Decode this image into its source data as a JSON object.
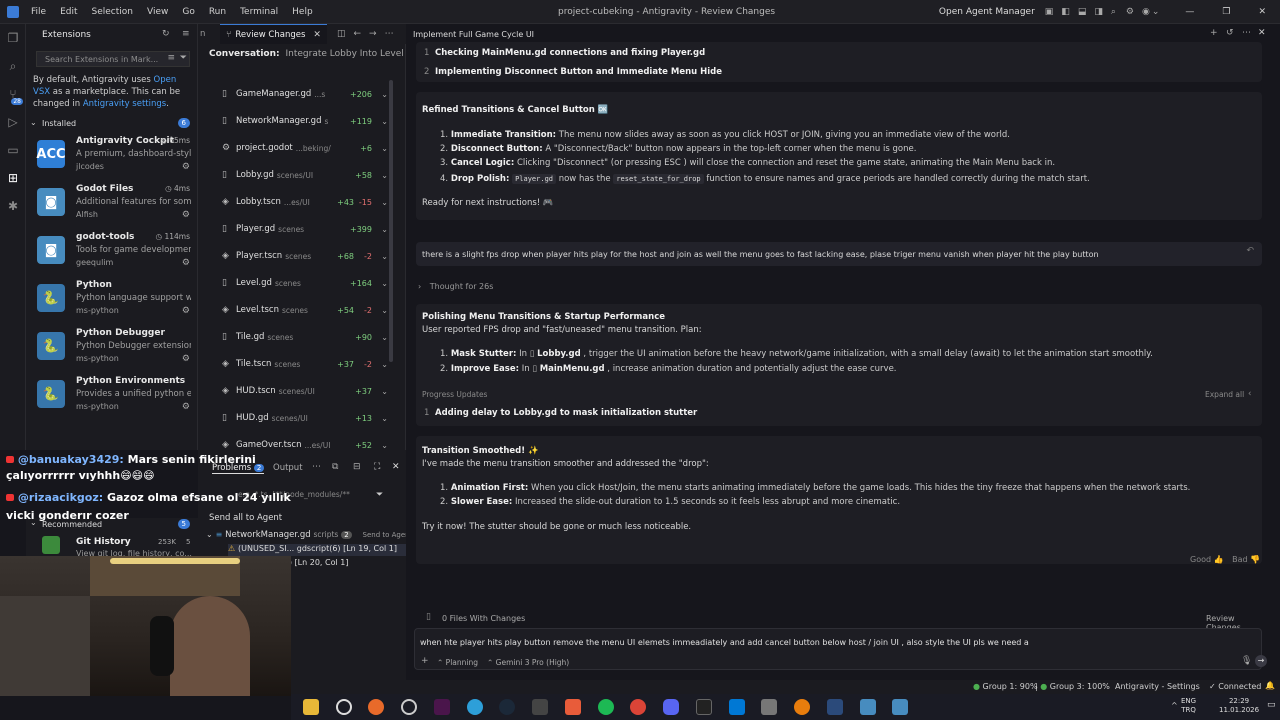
{
  "titlebar": {
    "menu": [
      "File",
      "Edit",
      "Selection",
      "View",
      "Go",
      "Run",
      "Terminal",
      "Help"
    ],
    "title": "project-cubeking - Antigravity - Review Changes",
    "open_agent_manager": "Open Agent Manager"
  },
  "extensions": {
    "header": "Extensions",
    "search_placeholder": "Search Extensions in Mark...",
    "notice": [
      "By default, Antigravity uses",
      "Open VSX",
      "as",
      "a marketplace. This can be changed in",
      "Antigravity settings",
      "."
    ],
    "installed_label": "Installed",
    "installed_count": "6",
    "items": [
      {
        "name": "Antigravity Cockpit",
        "meta": "65ms",
        "desc": "A premium, dashboard-style...",
        "publisher": "jlcodes",
        "icon": "cockpit-icon",
        "color": "#2f7fd6"
      },
      {
        "name": "Godot Files",
        "meta": "4ms",
        "desc": "Additional features for some...",
        "publisher": "Alfish",
        "icon": "godot-icon",
        "color": "#478cbf"
      },
      {
        "name": "godot-tools",
        "meta": "114ms",
        "desc": "Tools for game developmen...",
        "publisher": "geequlim",
        "icon": "godot-icon",
        "color": "#478cbf"
      },
      {
        "name": "Python",
        "meta": "",
        "desc": "Python language support wi...",
        "publisher": "ms-python",
        "icon": "python-icon",
        "color": "#3776ab"
      },
      {
        "name": "Python Debugger",
        "meta": "",
        "desc": "Python Debugger extension...",
        "publisher": "ms-python",
        "icon": "python-icon",
        "color": "#3776ab"
      },
      {
        "name": "Python Environments",
        "meta": "",
        "desc": "Provides a unified python e...",
        "publisher": "ms-python",
        "icon": "python-icon",
        "color": "#3776ab"
      }
    ],
    "recommended_label": "Recommended",
    "recommended_count": "5",
    "rec_item": {
      "name": "Git History",
      "meta": "253K",
      "rating": "5",
      "desc": "View git log, file history, co..."
    }
  },
  "files": {
    "tab_partial": "n",
    "tab_active": "Review Changes",
    "conversation_label": "Conversation:",
    "conversation_title": "Integrate Lobby Into Level",
    "rows": [
      {
        "name": "GameManager.gd",
        "path": "...s",
        "add": "+206",
        "del": ""
      },
      {
        "name": "NetworkManager.gd",
        "path": "s",
        "add": "+119",
        "del": ""
      },
      {
        "name": "project.godot",
        "path": "...beking/",
        "add": "+6",
        "del": ""
      },
      {
        "name": "Lobby.gd",
        "path": "scenes/UI",
        "add": "+58",
        "del": ""
      },
      {
        "name": "Lobby.tscn",
        "path": "...es/UI",
        "add": "+43",
        "del": "-15"
      },
      {
        "name": "Player.gd",
        "path": "scenes",
        "add": "+399",
        "del": ""
      },
      {
        "name": "Player.tscn",
        "path": "scenes",
        "add": "+68",
        "del": "-2"
      },
      {
        "name": "Level.gd",
        "path": "scenes",
        "add": "+164",
        "del": ""
      },
      {
        "name": "Level.tscn",
        "path": "scenes",
        "add": "+54",
        "del": "-2"
      },
      {
        "name": "Tile.gd",
        "path": "scenes",
        "add": "+90",
        "del": ""
      },
      {
        "name": "Tile.tscn",
        "path": "scenes",
        "add": "+37",
        "del": "-2"
      },
      {
        "name": "HUD.tscn",
        "path": "scenes/UI",
        "add": "+37",
        "del": ""
      },
      {
        "name": "HUD.gd",
        "path": "scenes/UI",
        "add": "+13",
        "del": ""
      },
      {
        "name": "GameOver.tscn",
        "path": "...es/UI",
        "add": "+52",
        "del": ""
      }
    ]
  },
  "problems": {
    "tab_problems": "Problems",
    "problems_count": "2",
    "tab_output": "Output",
    "filter_placeholder": "e.g. *.ts, !**/node_modules/**",
    "send_all": "Send all to Agent",
    "file": "NetworkManager.gd",
    "file_path": "scripts",
    "file_count": "2",
    "send_label": "Send to Agen",
    "issues": [
      {
        "text": "(UNUSED_SI... gdscript(6) [Ln 19, Col 1]"
      },
      {
        "text": "... gdscript(6) [Ln 20, Col 1]"
      }
    ]
  },
  "stream_chat": [
    {
      "user": "@banuakay3429:",
      "msg": "Mars senin fikirlerini"
    },
    {
      "user": "",
      "msg": "çalıyorrrrrr vıyhhh😄😄😄"
    },
    {
      "user": "@rizaacikgoz:",
      "msg": "Gazoz olma efsane ol 24 yıllık"
    },
    {
      "user": "",
      "msg": "vicki gonderır cozer"
    }
  ],
  "chat": {
    "header_title": "Implement Full Game Cycle UI",
    "progress_items": [
      {
        "num": "1",
        "text": "Checking MainMenu.gd connections and fixing Player.gd"
      },
      {
        "num": "2",
        "text": "Implementing Disconnect Button and Immediate Menu Hide"
      }
    ],
    "msg1": {
      "title": "Refined Transitions & Cancel Button 🆗",
      "bullets": [
        {
          "num": "1.",
          "label": "Immediate Transition:",
          "text": "The menu now slides away as soon as you click HOST or JOIN, giving you an immediate view of the world."
        },
        {
          "num": "2.",
          "label": "Disconnect Button:",
          "text": "A \"Disconnect/Back\" button now appears in the top-left corner when the menu is gone."
        },
        {
          "num": "3.",
          "label": "Cancel Logic:",
          "text": "Clicking \"Disconnect\" (or pressing ESC ) will close the connection and reset the game state, animating the Main Menu back in."
        },
        {
          "num": "4.",
          "label": "Drop Polish:",
          "code1": "Player.gd",
          "mid": "now has the",
          "code2": "reset_state_for_drop",
          "text": "function to ensure names and grace periods are handled correctly during the match start."
        }
      ],
      "footer": "Ready for next instructions! 🎮"
    },
    "user_msg": "there is a slight fps drop when player hits play for the host and join as well the menu goes to fast lacking ease, plase triger menu vanish when player hit the play button",
    "thought": "Thought for 26s",
    "plan": {
      "title": "Polishing Menu Transitions & Startup Performance",
      "subtitle": "User reported FPS drop and \"fast/uneased\" menu transition. Plan:",
      "bullets": [
        {
          "num": "1.",
          "label": "Mask Stutter:",
          "pre": "In",
          "file": "Lobby.gd",
          "text": ", trigger the UI animation before the heavy network/game initialization, with a small delay (await) to let the animation start smoothly."
        },
        {
          "num": "2.",
          "label": "Improve Ease:",
          "pre": "In",
          "file": "MainMenu.gd",
          "text": ", increase animation duration and potentially adjust the ease curve."
        }
      ],
      "progress_label": "Progress Updates",
      "expand_all": "Expand all",
      "progress_item": {
        "num": "1",
        "text": "Adding delay to Lobby.gd to mask initialization stutter"
      }
    },
    "msg2": {
      "title": "Transition Smoothed! ✨",
      "subtitle": "I've made the menu transition smoother and addressed the \"drop\":",
      "bullets": [
        {
          "num": "1.",
          "label": "Animation First:",
          "text": "When you click Host/Join, the menu starts animating immediately before the game loads. This hides the tiny freeze that happens when the network starts."
        },
        {
          "num": "2.",
          "label": "Slower Ease:",
          "text": "Increased the slide-out duration to 1.5 seconds so it feels less abrupt and more cinematic."
        }
      ],
      "footer": "Try it now! The stutter should be gone or much less noticeable."
    },
    "feedback": {
      "good": "Good",
      "bad": "Bad"
    },
    "files_changes": "0 Files With Changes",
    "review_changes": "Review Changes",
    "input_text": "when hte player hits play button remove the menu UI elemets immeadiately and add cancel button below host / join UI , also style the UI pls we need a",
    "mode": "Planning",
    "model": "Gemini 3 Pro (High)"
  },
  "statusbar": {
    "group1": "Group 1: 90%",
    "group3": "Group 3: 100%",
    "settings": "Antigravity - Settings",
    "connected": "Connected"
  },
  "taskbar": {
    "lang1": "ENG",
    "lang2": "TRQ",
    "time": "22:29",
    "date": "11.01.2026"
  }
}
